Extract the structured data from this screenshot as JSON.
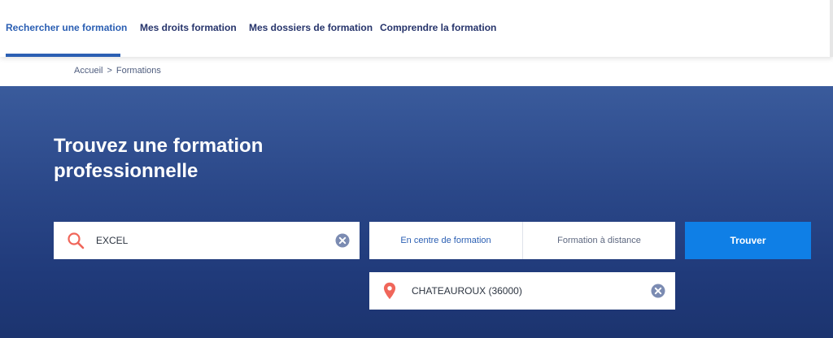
{
  "nav": {
    "tabs": [
      {
        "label": "Rechercher une formation",
        "active": true
      },
      {
        "label": "Mes droits formation",
        "active": false
      },
      {
        "label": "Mes dossiers de formation",
        "active": false
      },
      {
        "label": "Comprendre la formation",
        "active": false
      }
    ]
  },
  "breadcrumb": {
    "home": "Accueil",
    "separator": ">",
    "current": "Formations"
  },
  "hero": {
    "title": "Trouvez une formation professionnelle"
  },
  "search": {
    "keyword_value": "EXCEL",
    "search_icon": "search-icon",
    "clear_icon": "close-circle-icon",
    "mode_tabs": [
      {
        "label": "En centre de formation",
        "active": true
      },
      {
        "label": "Formation à distance",
        "active": false
      }
    ],
    "submit_label": "Trouver",
    "location_value": "CHATEAUROUX (36000)",
    "location_icon": "map-pin-icon"
  },
  "colors": {
    "accent": "#2b5fb3",
    "nav_text": "#26346b",
    "button": "#0f7fe6",
    "hero_top": "#3a5b9c",
    "hero_bottom": "#1c346f",
    "search_icon": "#f0665a",
    "clear_icon": "#7b8bb2"
  }
}
